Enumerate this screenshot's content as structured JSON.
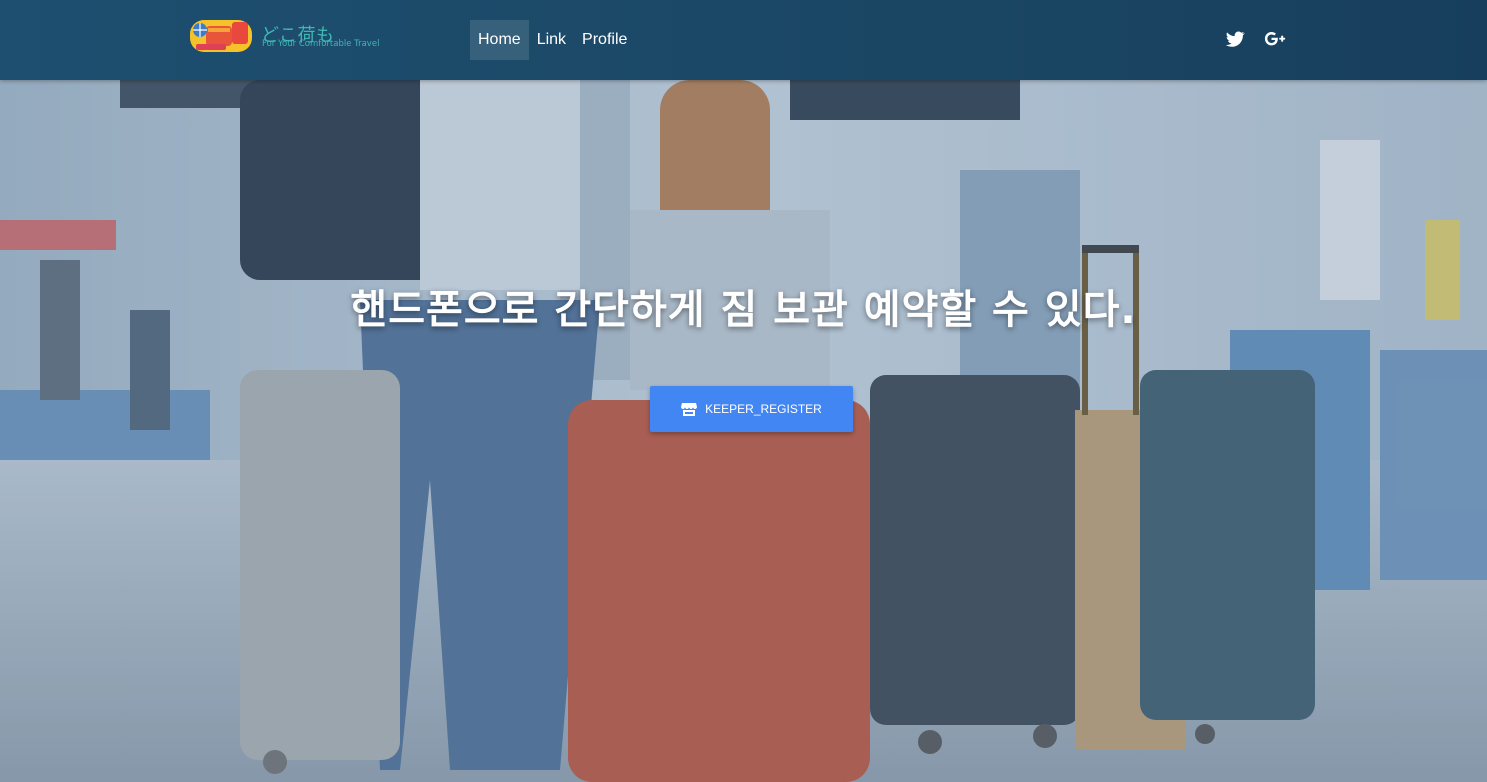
{
  "logo": {
    "brand": "どこ荷も",
    "tagline": "For Your Comfortable Travel"
  },
  "nav": {
    "items": [
      {
        "label": "Home",
        "active": true
      },
      {
        "label": "Link",
        "active": false
      },
      {
        "label": "Profile",
        "active": false
      }
    ]
  },
  "social": {
    "icons": [
      "twitter-icon",
      "google-plus-icon"
    ]
  },
  "hero": {
    "headline": "핸드폰으로 간단하게 짐 보관 예약할 수 있다.",
    "button_label": "KEEPER_REGISTER",
    "button_icon": "store-icon"
  },
  "colors": {
    "navbar": "#1b4866",
    "accent_button": "#4286f4",
    "logo_text": "#3fb8b4"
  }
}
